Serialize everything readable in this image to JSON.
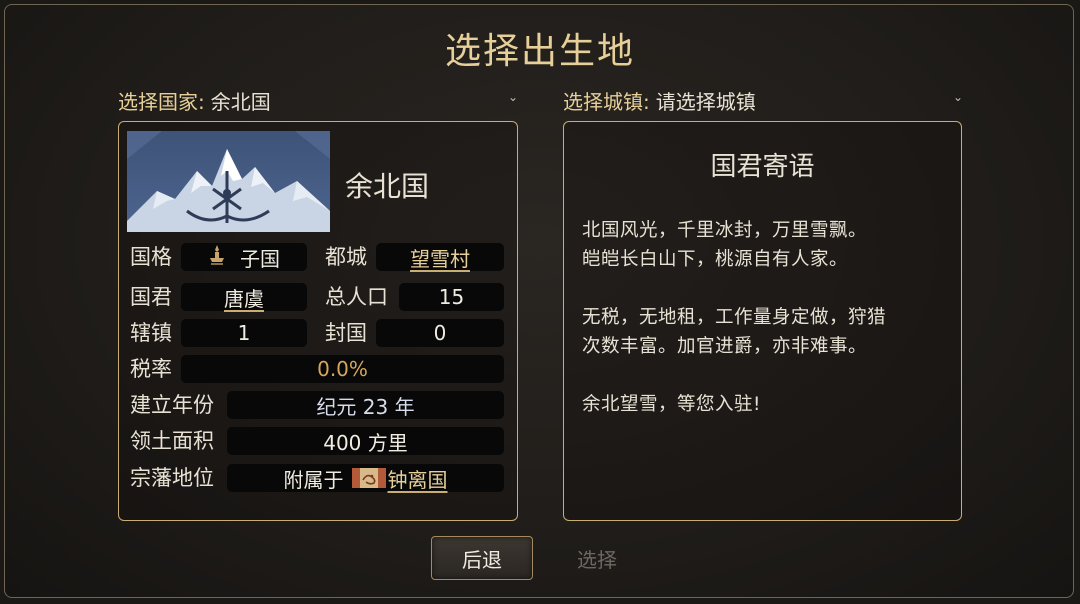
{
  "dialog": {
    "title": "选择出生地"
  },
  "country_select": {
    "label": "选择国家:",
    "value": "余北国"
  },
  "town_select": {
    "label": "选择城镇:",
    "value": "请选择城镇"
  },
  "country": {
    "name": "余北国",
    "rank_label": "国格",
    "rank_value": "子国",
    "capital_label": "都城",
    "capital_value": "望雪村",
    "ruler_label": "国君",
    "ruler_value": "唐虞",
    "population_label": "总人口",
    "population_value": "15",
    "towns_label": "辖镇",
    "towns_value": "1",
    "fiefs_label": "封国",
    "fiefs_value": "0",
    "tax_label": "税率",
    "tax_value": "0.0%",
    "founded_label": "建立年份",
    "founded_value": "纪元 23 年",
    "area_label": "领土面积",
    "area_value": "400 方里",
    "vassal_label": "宗藩地位",
    "vassal_prefix": "附属于",
    "vassal_overlord": "钟离国"
  },
  "message": {
    "title": "国君寄语",
    "lines1": [
      "北国风光，千里冰封，万里雪飘。",
      "皑皑长白山下，桃源自有人家。"
    ],
    "lines2": [
      "无税，无地租，工作量身定做，狩猎",
      "次数丰富。加官进爵，亦非难事。"
    ],
    "lines3": [
      "余北望雪，等您入驻!"
    ]
  },
  "buttons": {
    "back": "后退",
    "select": "选择"
  },
  "colors": {
    "accent": "#e6cf98",
    "border": "#c8ad74",
    "tax": "#d4a75e",
    "disabled": "#6d6760"
  }
}
